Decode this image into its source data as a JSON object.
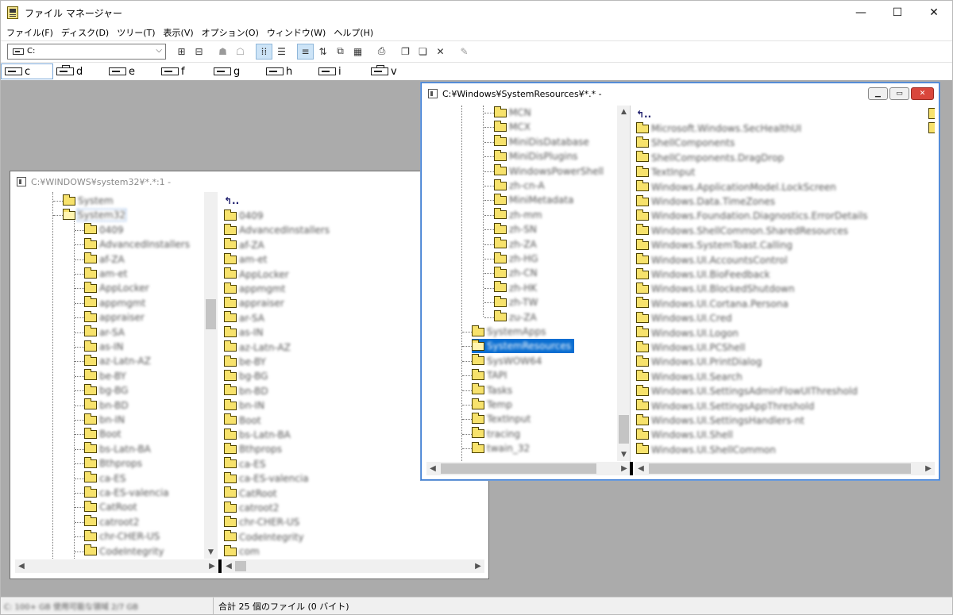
{
  "app": {
    "title": "ファイル マネージャー",
    "controls": {
      "minimize": "—",
      "maximize": "☐",
      "close": "✕"
    }
  },
  "menu": [
    "ファイル(F)",
    "ディスク(D)",
    "ツリー(T)",
    "表示(V)",
    "オプション(O)",
    "ウィンドウ(W)",
    "ヘルプ(H)"
  ],
  "toolbar": {
    "drive_value": "C:",
    "buttons": [
      "connect-drive",
      "disconnect-drive",
      "share",
      "stop-share",
      "large-icons",
      "list-view",
      "details-view",
      "partial-details",
      "sort-by-name",
      "copy-disk",
      "print",
      "copy",
      "paste",
      "delete",
      "properties"
    ]
  },
  "drives": [
    {
      "letter": "c",
      "selected": true
    },
    {
      "letter": "d",
      "selected": false,
      "type": "network"
    },
    {
      "letter": "e",
      "selected": false
    },
    {
      "letter": "f",
      "selected": false
    },
    {
      "letter": "g",
      "selected": false
    },
    {
      "letter": "h",
      "selected": false
    },
    {
      "letter": "i",
      "selected": false
    },
    {
      "letter": "v",
      "selected": false,
      "type": "network"
    }
  ],
  "window1": {
    "title": "C:¥WINDOWS¥system32¥*.*:1 -",
    "tree": [
      "System",
      "System32",
      "0409",
      "AdvancedInstallers",
      "af-ZA",
      "am-et",
      "AppLocker",
      "appmgmt",
      "appraiser",
      "ar-SA",
      "as-IN",
      "az-Latn-AZ",
      "be-BY",
      "bg-BG",
      "bn-BD",
      "bn-IN",
      "Boot",
      "bs-Latn-BA",
      "Bthprops",
      "ca-ES",
      "ca-ES-valencia",
      "CatRoot",
      "catroot2",
      "chr-CHER-US",
      "CodeIntegrity"
    ],
    "files": [
      "0409",
      "AdvancedInstallers",
      "af-ZA",
      "am-et",
      "AppLocker",
      "appmgmt",
      "appraiser",
      "ar-SA",
      "as-IN",
      "az-Latn-AZ",
      "be-BY",
      "bg-BG",
      "bn-BD",
      "bn-IN",
      "Boot",
      "bs-Latn-BA",
      "Bthprops",
      "ca-ES",
      "ca-ES-valencia",
      "CatRoot",
      "catroot2",
      "chr-CHER-US",
      "CodeIntegrity",
      "com"
    ]
  },
  "window2": {
    "title": "C:¥Windows¥SystemResources¥*.* -",
    "tree": [
      "MCN",
      "MCX",
      "MiniDisDatabase",
      "MiniDisPlugins",
      "WindowsPowerShell",
      "zh-cn-A",
      "MiniMetadata",
      "zh-mm",
      "zh-SN",
      "zh-ZA",
      "zh-HG",
      "zh-CN",
      "zh-HK",
      "zh-TW",
      "zu-ZA",
      "SystemApps",
      "SystemResources",
      "SysWOW64",
      "TAPI",
      "Tasks",
      "Temp",
      "TextInput",
      "tracing",
      "twain_32"
    ],
    "files": [
      "Microsoft.Windows.SecHealthUI",
      "ShellComponents",
      "ShellComponents.DragDrop",
      "TextInput",
      "Windows.ApplicationModel.LockScreen",
      "Windows.Data.TimeZones",
      "Windows.Foundation.Diagnostics.ErrorDetails",
      "Windows.ShellCommon.SharedResources",
      "Windows.SystemToast.Calling",
      "Windows.UI.AccountsControl",
      "Windows.UI.BioFeedback",
      "Windows.UI.BlockedShutdown",
      "Windows.UI.Cortana.Persona",
      "Windows.UI.Cred",
      "Windows.UI.Logon",
      "Windows.UI.PCShell",
      "Windows.UI.PrintDialog",
      "Windows.UI.Search",
      "Windows.UI.SettingsAdminFlowUIThreshold",
      "Windows.UI.SettingsAppThreshold",
      "Windows.UI.SettingsHandlers-nt",
      "Windows.UI.Shell",
      "Windows.UI.ShellCommon"
    ]
  },
  "status": {
    "left": "C: 100+ GB 使用可能な領域 2/7 GB",
    "right": "合計 25 個のファイル (0 バイト)"
  }
}
